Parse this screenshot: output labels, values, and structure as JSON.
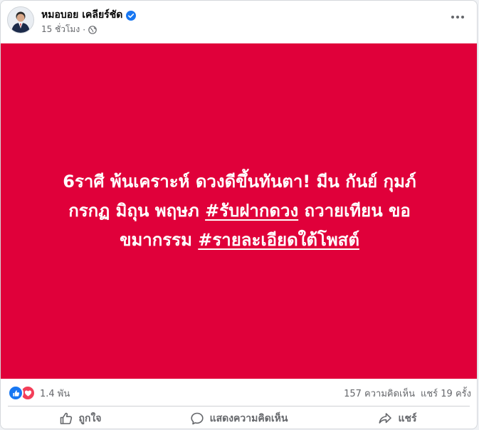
{
  "post": {
    "author": "หมอบอย เคลียร์ชัด",
    "time": "15 ชั่วโมง",
    "separator": "·",
    "image_text": {
      "line1": "6ราศี พ้นเคราะห์ ดวงดีขึ้นทันตา! มีน กันย์ กุมภ์",
      "line2_plain": "กรกฏ มิถุน พฤษภ ",
      "line2_tag": "#รับฝากดวง",
      "line2_end": " ถวายเทียน ขอ",
      "line3_plain": "ขมากรรม ",
      "line3_tag": "#รายละเอียดใต้โพสต์"
    },
    "background_color": "#e0003a"
  },
  "stats": {
    "reactions_count": "1.4 พัน",
    "comments": "157 ความคิดเห็น",
    "shares": "แชร์ 19 ครั้ง"
  },
  "actions": {
    "like": "ถูกใจ",
    "comment": "แสดงความคิดเห็น",
    "share": "แชร์"
  },
  "icons": {
    "verified": "verified-badge-icon",
    "privacy": "globe-icon",
    "more": "more-options-icon",
    "like_reaction": "thumbs-up-icon",
    "love_reaction": "heart-icon"
  },
  "colors": {
    "brand_blue": "#1877f2",
    "love_red": "#f33e58",
    "muted_text": "#65676b"
  }
}
